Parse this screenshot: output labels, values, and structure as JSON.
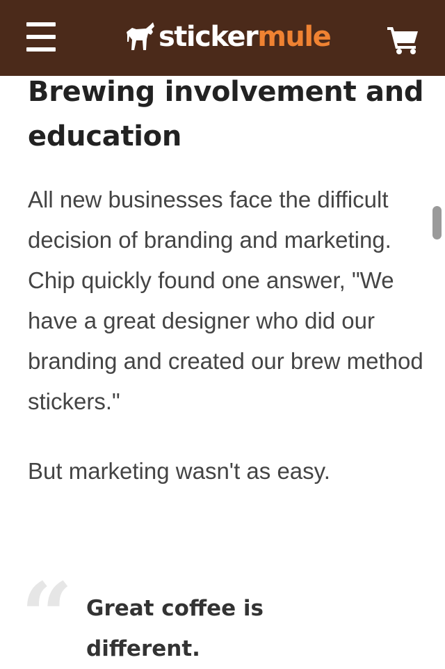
{
  "header": {
    "logo_part1": "sticker",
    "logo_part2": "mule",
    "brand_bg": "#4b2a1a",
    "accent": "#ef8232",
    "icons": [
      "menu-icon",
      "mule-logo-icon",
      "cart-icon"
    ]
  },
  "article": {
    "heading": "Brewing involvement and education",
    "paragraphs": [
      "All new businesses face the difficult decision of branding and marketing. Chip quickly found one answer, \"We have a great designer who did our branding and created our brew method stickers.\"",
      "But marketing wasn't as easy."
    ],
    "quote_mark": "“",
    "quote": "Great coffee is different."
  }
}
